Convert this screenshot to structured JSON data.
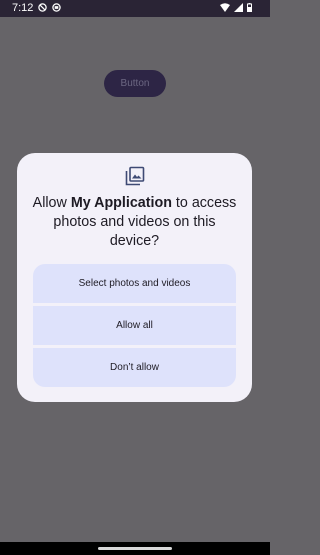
{
  "status_bar": {
    "time": "7:12",
    "left_icons": [
      "do-not-disturb-icon",
      "data-saver-icon"
    ],
    "right_icons": [
      "wifi-icon",
      "signal-icon",
      "battery-icon"
    ]
  },
  "app": {
    "button_label": "Button"
  },
  "dialog": {
    "icon": "photo-library-icon",
    "title_prefix": "Allow ",
    "app_name": "My Application",
    "title_suffix": " to access photos and videos on this device?",
    "options": [
      {
        "label": "Select photos and videos"
      },
      {
        "label": "Allow all"
      },
      {
        "label": "Don’t allow"
      }
    ]
  },
  "colors": {
    "scrim": "#666468",
    "status_bar": "#2a2435",
    "dialog_bg": "#f3f1f9",
    "option_bg": "#dee2fb",
    "app_button": "#2d2545",
    "accent_icon": "#3e4a74"
  }
}
